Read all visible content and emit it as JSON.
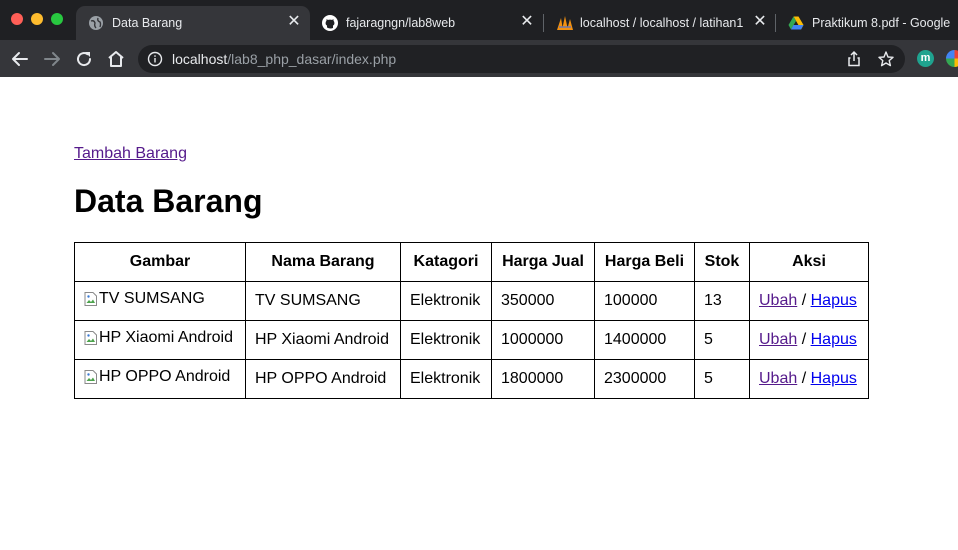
{
  "browser": {
    "tabs": [
      {
        "title": "Data Barang",
        "icon": "globe-icon",
        "active": true
      },
      {
        "title": "fajaragngn/lab8web",
        "icon": "github-icon",
        "active": false
      },
      {
        "title": "localhost / localhost / latihan1",
        "icon": "phpmyadmin-icon",
        "active": false
      },
      {
        "title": "Praktikum 8.pdf - Google",
        "icon": "google-drive-icon",
        "active": false
      }
    ],
    "close_glyph": "✕",
    "address": {
      "host": "localhost",
      "path": "/lab8_php_dasar/index.php"
    },
    "extension_letter": "m"
  },
  "page": {
    "add_link": "Tambah Barang",
    "title": "Data Barang",
    "table": {
      "headers": [
        "Gambar",
        "Nama Barang",
        "Katagori",
        "Harga Jual",
        "Harga Beli",
        "Stok",
        "Aksi"
      ],
      "rows": [
        {
          "image_alt": "TV SUMSANG",
          "name": "TV SUMSANG",
          "category": "Elektronik",
          "sell_price": "350000",
          "buy_price": "100000",
          "stock": "13"
        },
        {
          "image_alt": "HP Xiaomi Android",
          "name": "HP Xiaomi Android",
          "category": "Elektronik",
          "sell_price": "1000000",
          "buy_price": "1400000",
          "stock": "5"
        },
        {
          "image_alt": "HP OPPO Android",
          "name": "HP OPPO Android",
          "category": "Elektronik",
          "sell_price": "1800000",
          "buy_price": "2300000",
          "stock": "5"
        }
      ],
      "actions": {
        "edit": "Ubah",
        "separator": "/",
        "delete": "Hapus"
      }
    }
  },
  "colors": {
    "tabbar_bg": "#1f2023",
    "toolbar_bg": "#35363a",
    "visited_link": "#551a8b",
    "link": "#0000ee"
  }
}
